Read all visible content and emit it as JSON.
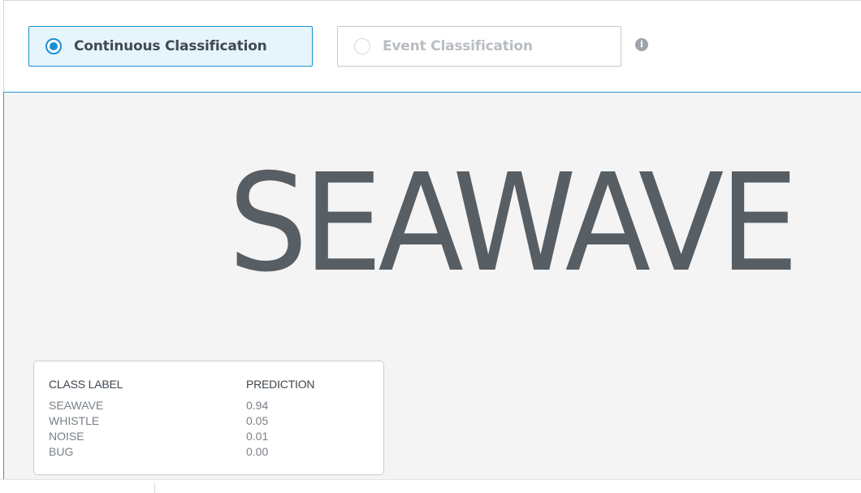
{
  "mode_selector": {
    "continuous_label": "Continuous Classification",
    "event_label": "Event Classification",
    "selected": "Continuous Classification",
    "info_icon": "info-icon"
  },
  "display": {
    "top_class": "SEAWAVE"
  },
  "prediction_table": {
    "headers": {
      "class_label": "CLASS LABEL",
      "prediction": "PREDICTION"
    },
    "rows": [
      {
        "label": "SEAWAVE",
        "prediction": "0.94"
      },
      {
        "label": "WHISTLE",
        "prediction": "0.05"
      },
      {
        "label": "NOISE",
        "prediction": "0.01"
      },
      {
        "label": "BUG",
        "prediction": "0.00"
      }
    ]
  },
  "colors": {
    "accent": "#1b8fd3",
    "selected_bg": "#e6f4fb",
    "panel_bg": "#f4f4f4",
    "big_text": "#575e64"
  }
}
